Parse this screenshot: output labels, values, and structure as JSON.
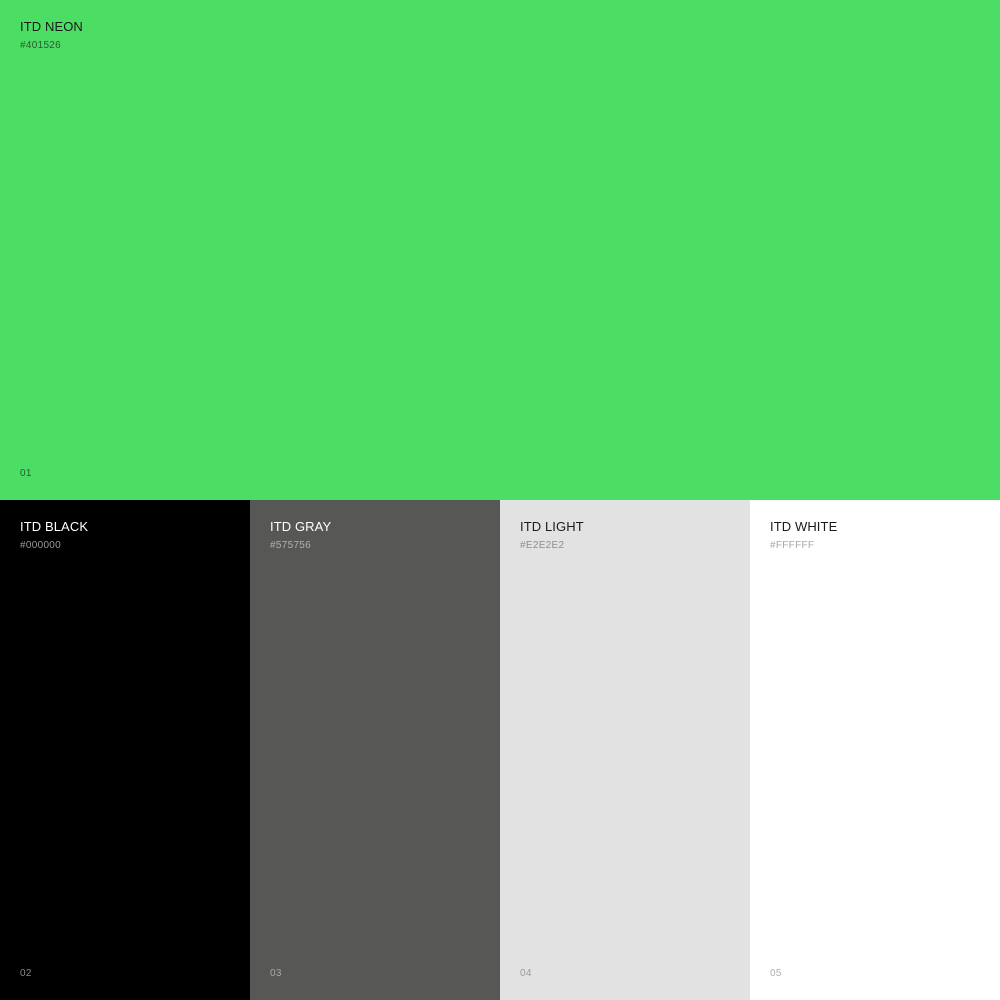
{
  "primary": {
    "name": "ITD NEON",
    "hex_label": "#401526",
    "index": "01",
    "color": "#4CDE64",
    "text_color": "#1A1A1A",
    "hex_color": "#2A5A32",
    "index_color": "#2A5A32"
  },
  "swatches": [
    {
      "name": "ITD BLACK",
      "hex_label": "#000000",
      "index": "02",
      "color": "#000000",
      "text_color": "#FFFFFF",
      "hex_color": "#9A9A9A",
      "index_color": "#8A8A8A"
    },
    {
      "name": "ITD GRAY",
      "hex_label": "#575756",
      "index": "03",
      "color": "#575756",
      "text_color": "#FFFFFF",
      "hex_color": "#B0B0B0",
      "index_color": "#A8A8A8"
    },
    {
      "name": "ITD LIGHT",
      "hex_label": "#E2E2E2",
      "index": "04",
      "color": "#E2E2E2",
      "text_color": "#1A1A1A",
      "hex_color": "#8E8E8E",
      "index_color": "#9A9A9A"
    },
    {
      "name": "ITD WHITE",
      "hex_label": "#FFFFFF",
      "index": "05",
      "color": "#FFFFFF",
      "text_color": "#1A1A1A",
      "hex_color": "#A8A8A8",
      "index_color": "#B0B0B0"
    }
  ]
}
